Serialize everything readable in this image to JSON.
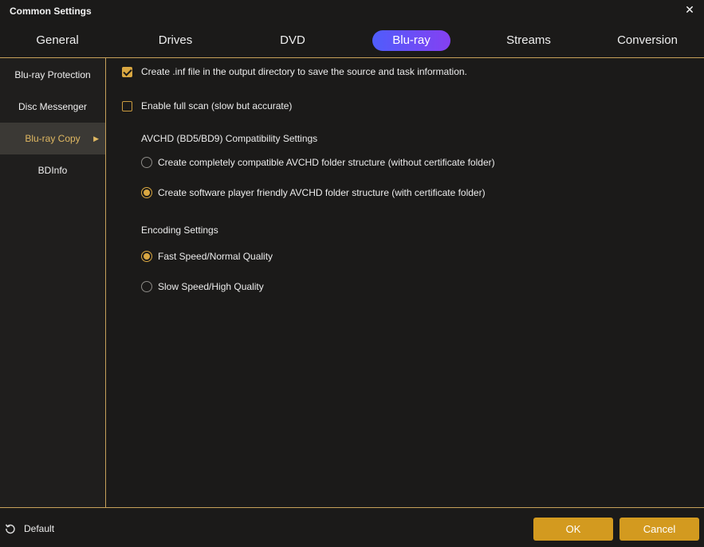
{
  "window": {
    "title": "Common Settings",
    "close_glyph": "✕"
  },
  "tabs": [
    {
      "label": "General",
      "active": false
    },
    {
      "label": "Drives",
      "active": false
    },
    {
      "label": "DVD",
      "active": false
    },
    {
      "label": "Blu-ray",
      "active": true
    },
    {
      "label": "Streams",
      "active": false
    },
    {
      "label": "Conversion",
      "active": false
    }
  ],
  "sidebar": {
    "items": [
      {
        "label": "Blu-ray Protection",
        "active": false
      },
      {
        "label": "Disc Messenger",
        "active": false
      },
      {
        "label": "Blu-ray Copy",
        "active": true,
        "arrow": "▶"
      },
      {
        "label": "BDInfo",
        "active": false
      }
    ]
  },
  "content": {
    "create_inf": {
      "label": "Create .inf file in the output directory to save the source and task information.",
      "checked": true
    },
    "full_scan": {
      "label": "Enable full scan (slow but accurate)",
      "checked": false
    },
    "avchd": {
      "title": "AVCHD (BD5/BD9) Compatibility Settings",
      "options": [
        {
          "label": "Create completely compatible AVCHD folder structure (without certificate folder)",
          "selected": false
        },
        {
          "label": "Create software player friendly AVCHD folder structure (with certificate folder)",
          "selected": true
        }
      ]
    },
    "encoding": {
      "title": "Encoding Settings",
      "options": [
        {
          "label": "Fast Speed/Normal Quality",
          "selected": true
        },
        {
          "label": "Slow Speed/High Quality",
          "selected": false
        }
      ]
    }
  },
  "footer": {
    "default_label": "Default",
    "ok_label": "OK",
    "cancel_label": "Cancel"
  },
  "colors": {
    "accent": "#d9a741",
    "button": "#d39a1f",
    "tab_active_start": "#4f5dfb",
    "tab_active_end": "#8540f2",
    "background": "#1b1a19"
  },
  "icons": {
    "close": "close-icon",
    "reset": "reset-icon",
    "chevron": "chevron-right-icon",
    "check": "checkmark-icon"
  }
}
